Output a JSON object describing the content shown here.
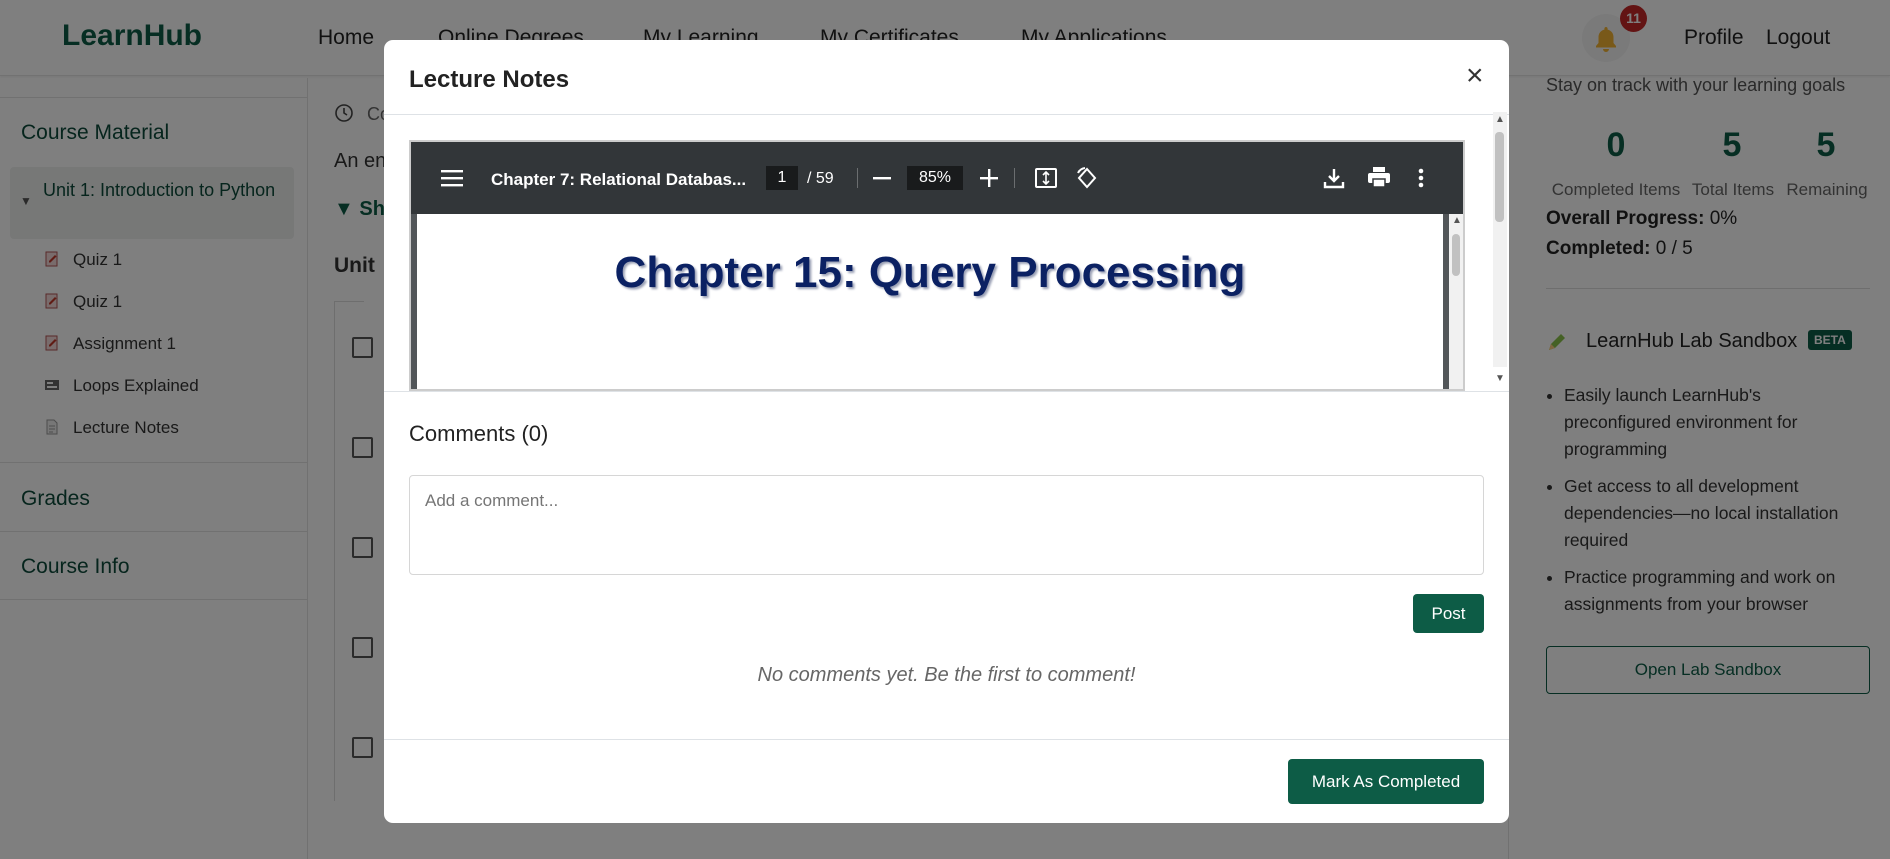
{
  "app": {
    "logo": "LearnHub",
    "nav": [
      "Home",
      "Online Degrees",
      "My Learning",
      "My Certificates",
      "My Applications"
    ],
    "notification_count": "11",
    "profile": "Profile",
    "logout": "Logout"
  },
  "sidebar": {
    "course_material": "Course Material",
    "unit_title": "Unit 1: Introduction to Python",
    "items": [
      "Quiz 1",
      "Quiz 1",
      "Assignment 1",
      "Loops Explained",
      "Lecture Notes"
    ],
    "grades": "Grades",
    "course_info": "Course Info"
  },
  "main": {
    "frag_time": "Co",
    "frag_desc": "An en",
    "frag_toggle": "Sh",
    "frag_unit": "Unit"
  },
  "right": {
    "subtitle": "Stay on track with your learning goals",
    "stats": [
      {
        "value": "0",
        "label": "Completed Items"
      },
      {
        "value": "5",
        "label": "Total Items"
      },
      {
        "value": "5",
        "label": "Remaining"
      }
    ],
    "overall_label": "Overall Progress:",
    "overall_value": "0%",
    "completed_label": "Completed:",
    "completed_value": "0 / 5",
    "lab_title": "LearnHub Lab Sandbox",
    "beta": "BETA",
    "bullets": [
      "Easily launch LearnHub's preconfigured environment for programming",
      "Get access to all development dependencies—no local installation required",
      "Practice programming and work on assignments from your browser"
    ],
    "open_lab": "Open Lab Sandbox"
  },
  "modal": {
    "title": "Lecture Notes",
    "close": "×",
    "pdf": {
      "title": "Chapter 7: Relational Databas...",
      "page": "1",
      "total": "/ 59",
      "zoom": "85%",
      "heading": "Chapter 15: Query Processing"
    },
    "comments_title": "Comments (0)",
    "comment_placeholder": "Add a comment...",
    "post": "Post",
    "no_comments": "No comments yet. Be the first to comment!",
    "mark_completed": "Mark As Completed"
  },
  "colors": {
    "brand": "#0d5c46",
    "badge": "#c62828",
    "pdf_toolbar": "#323639"
  }
}
